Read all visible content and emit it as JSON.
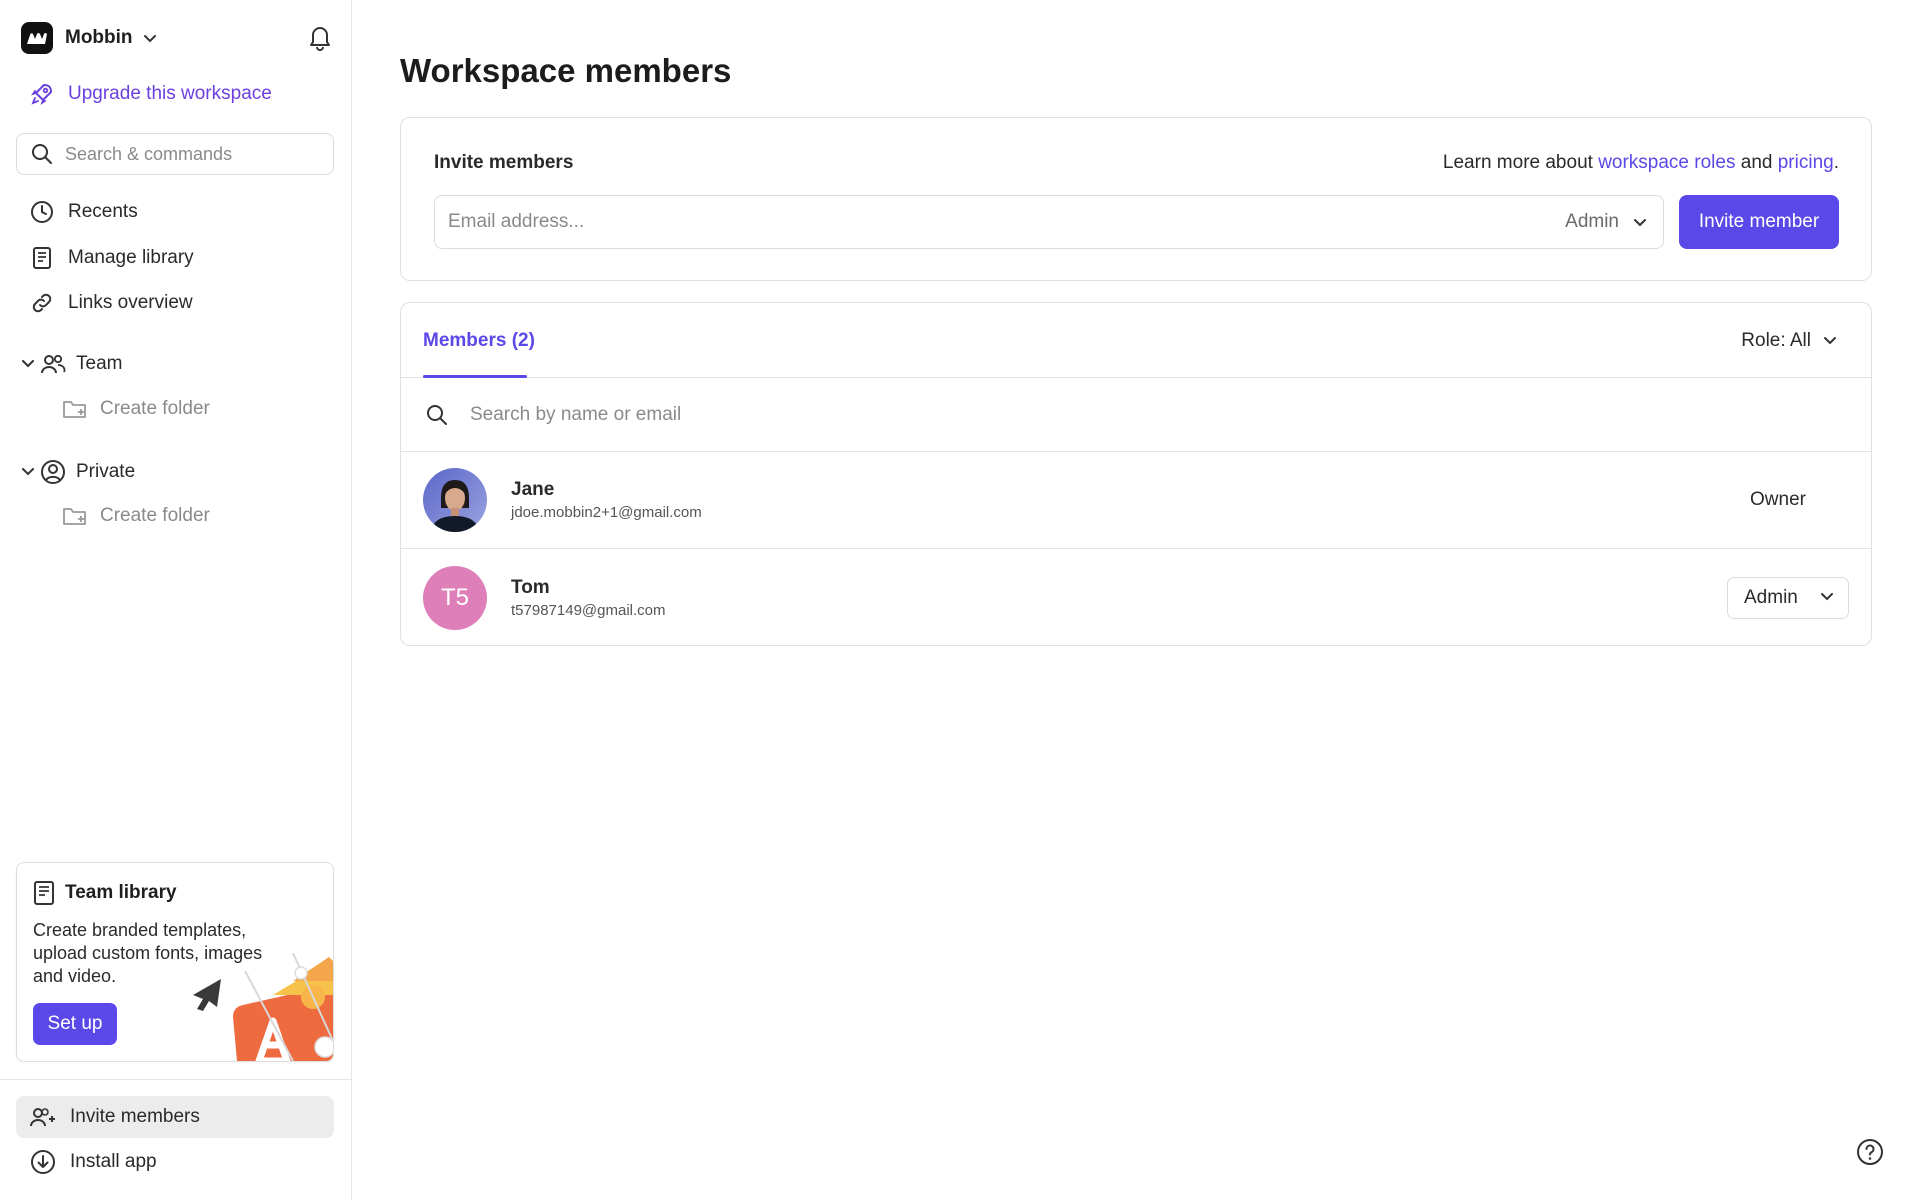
{
  "workspace": {
    "name": "Mobbin",
    "upgrade_label": "Upgrade this workspace"
  },
  "sidebar": {
    "search_placeholder": "Search & commands",
    "nav": [
      {
        "label": "Recents",
        "icon": "clock-icon"
      },
      {
        "label": "Manage library",
        "icon": "book-icon"
      },
      {
        "label": "Links overview",
        "icon": "link-icon"
      }
    ],
    "sections": [
      {
        "label": "Team",
        "icon": "team-icon",
        "child_label": "Create folder"
      },
      {
        "label": "Private",
        "icon": "user-circle-icon",
        "child_label": "Create folder"
      }
    ],
    "promo": {
      "title": "Team library",
      "description": "Create branded templates, upload custom fonts, images and video.",
      "button_label": "Set up"
    },
    "bottom": [
      {
        "label": "Invite members",
        "icon": "user-plus-icon",
        "active": true
      },
      {
        "label": "Install app",
        "icon": "download-icon",
        "active": false
      }
    ]
  },
  "main": {
    "title": "Workspace members",
    "invite": {
      "label": "Invite members",
      "learn_prefix": "Learn more about ",
      "learn_link1": "workspace roles",
      "learn_mid": " and ",
      "learn_link2": "pricing",
      "learn_suffix": ".",
      "email_placeholder": "Email address...",
      "role_value": "Admin",
      "button_label": "Invite member"
    },
    "members": {
      "tab_label": "Members (2)",
      "role_filter": "Role: All",
      "search_placeholder": "Search by name or email",
      "rows": [
        {
          "name": "Jane",
          "email": "jdoe.mobbin2+1@gmail.com",
          "role": "Owner",
          "avatar": "photo"
        },
        {
          "name": "Tom",
          "email": "t57987149@gmail.com",
          "role": "Admin",
          "avatar_initials": "T5"
        }
      ]
    }
  },
  "colors": {
    "accent": "#5b48e8",
    "upgrade": "#6b3fe0",
    "avatar_pink": "#de7fb9"
  }
}
